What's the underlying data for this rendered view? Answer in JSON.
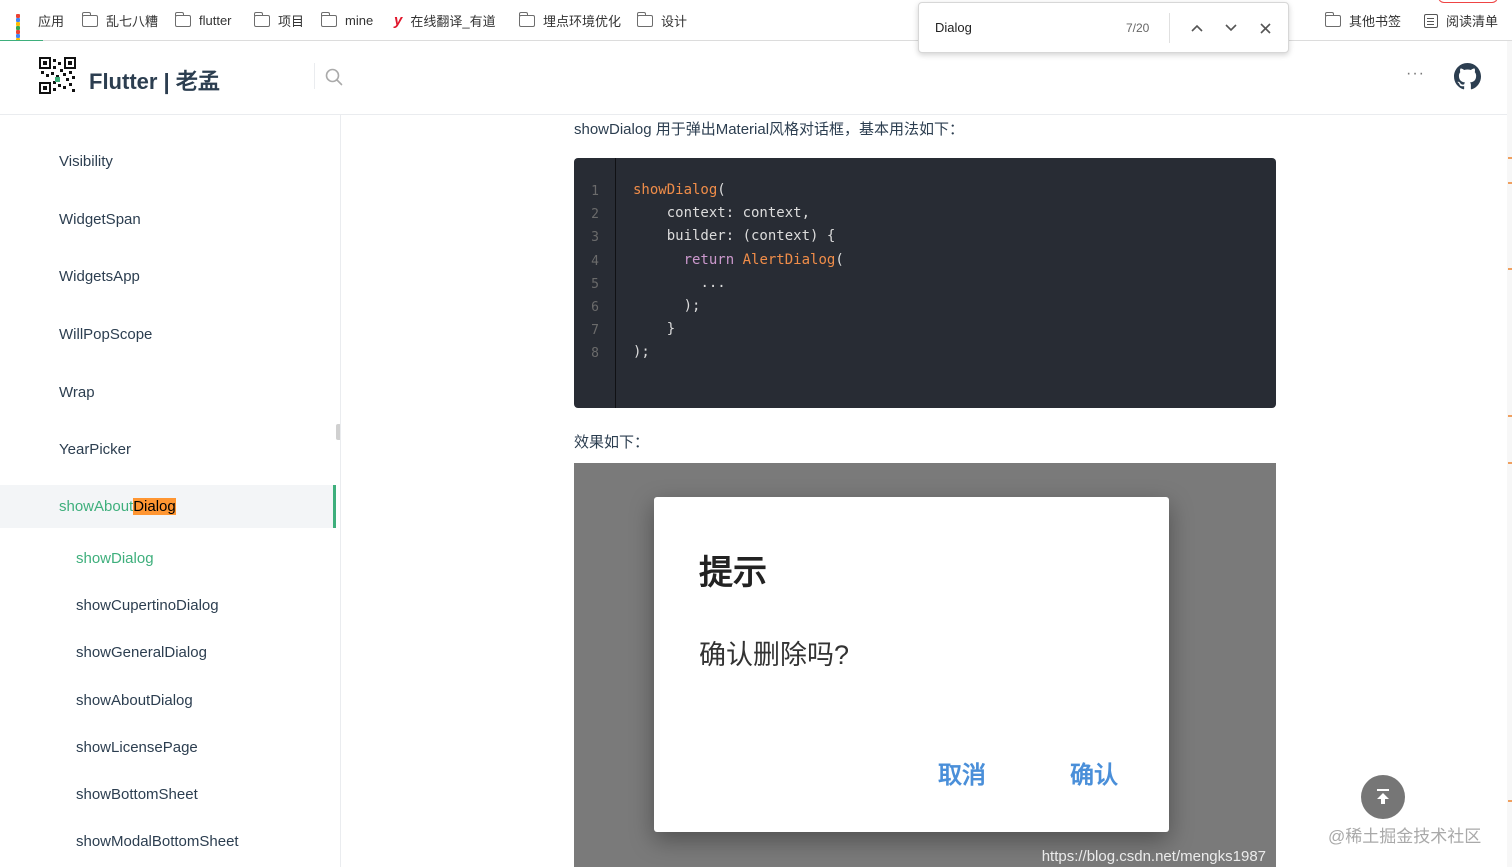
{
  "bookmarks": [
    {
      "label": "应用",
      "icon": "apps-grid-icon"
    },
    {
      "label": "乱七八糟",
      "icon": "folder-icon"
    },
    {
      "label": "flutter",
      "icon": "folder-icon"
    },
    {
      "label": "项目",
      "icon": "folder-icon"
    },
    {
      "label": "mine",
      "icon": "folder-icon"
    },
    {
      "label": "在线翻译_有道",
      "icon": "youdao-icon"
    },
    {
      "label": "埋点环境优化",
      "icon": "folder-icon"
    },
    {
      "label": "设计",
      "icon": "folder-icon"
    },
    {
      "label": "其他书签",
      "icon": "folder-icon"
    },
    {
      "label": "阅读清单",
      "icon": "reading-list-icon"
    }
  ],
  "find_bar": {
    "query": "Dialog",
    "count": "7/20"
  },
  "header": {
    "site_title": "Flutter | 老孟"
  },
  "sidebar": {
    "top_items": [
      "Visibility",
      "WidgetSpan",
      "WidgetsApp",
      "WillPopScope",
      "Wrap",
      "YearPicker"
    ],
    "active_item": {
      "prefix": "showAbout",
      "match": "Dialog"
    },
    "sub_items": [
      "showDialog",
      "showCupertinoDialog",
      "showGeneralDialog",
      "showAboutDialog",
      "showLicensePage",
      "showBottomSheet",
      "showModalBottomSheet"
    ],
    "current_sub": "showDialog"
  },
  "content": {
    "intro": "showDialog 用于弹出Material风格对话框，基本用法如下：",
    "code": {
      "line_numbers": [
        "1",
        "2",
        "3",
        "4",
        "5",
        "6",
        "7",
        "8"
      ],
      "lines": [
        {
          "indent": "",
          "parts": [
            {
              "t": "showDialog",
              "c": "fn"
            },
            {
              "t": "(",
              "c": ""
            }
          ]
        },
        {
          "indent": "    ",
          "parts": [
            {
              "t": "context: context,",
              "c": ""
            }
          ]
        },
        {
          "indent": "    ",
          "parts": [
            {
              "t": "builder: (context) {",
              "c": ""
            }
          ]
        },
        {
          "indent": "      ",
          "parts": [
            {
              "t": "return ",
              "c": "kw"
            },
            {
              "t": "AlertDialog",
              "c": "fn"
            },
            {
              "t": "(",
              "c": ""
            }
          ]
        },
        {
          "indent": "        ",
          "parts": [
            {
              "t": "...",
              "c": ""
            }
          ]
        },
        {
          "indent": "      ",
          "parts": [
            {
              "t": ");",
              "c": ""
            }
          ]
        },
        {
          "indent": "    ",
          "parts": [
            {
              "t": "}",
              "c": ""
            }
          ]
        },
        {
          "indent": "",
          "parts": [
            {
              "t": ");",
              "c": ""
            }
          ]
        }
      ]
    },
    "result_label": "效果如下：",
    "demo": {
      "dialog_title": "提示",
      "dialog_body": "确认删除吗?",
      "cancel_label": "取消",
      "confirm_label": "确认",
      "image_watermark": "https://blog.csdn.net/mengks1987"
    }
  },
  "page_watermark": "@稀土掘金技术社区",
  "colors": {
    "accent": "#3eaf7c",
    "search_highlight": "#ff9632",
    "code_bg": "#282c34",
    "code_function": "#f08d49",
    "code_keyword": "#cc99cd",
    "dialog_button": "#4a8fd9"
  }
}
